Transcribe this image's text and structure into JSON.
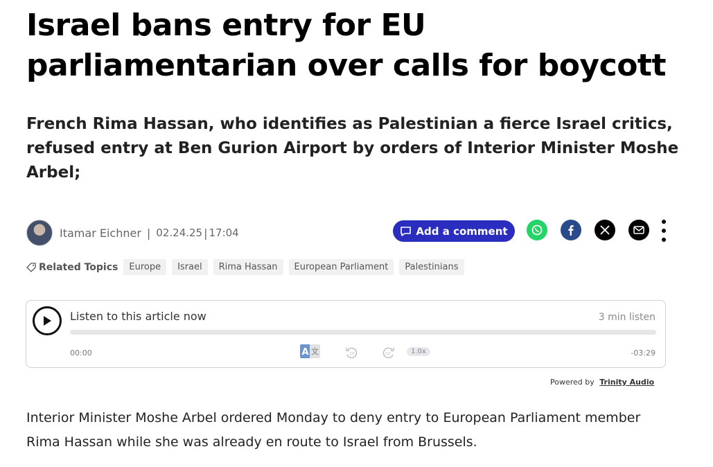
{
  "article": {
    "headline": "Israel bans entry for EU parliamentarian over calls for boycott",
    "subheadline": "French Rima Hassan, who identifies as Palestinian a fierce Israel critics, refused entry at Ben Gurion Airport  by orders of Interior Minister Moshe Arbel;",
    "author": "Itamar Eichner",
    "separator": "|",
    "date": "02.24.25",
    "time": "17:04",
    "body": "Interior Minister Moshe Arbel ordered Monday to deny entry to European Parliament member Rima Hassan while she was already en route to Israel from Brussels."
  },
  "actions": {
    "comment_label": "Add a comment",
    "share_icons": [
      "whatsapp-icon",
      "facebook-icon",
      "x-icon",
      "mail-icon"
    ],
    "colors": {
      "comment": "#2a2dbd",
      "whatsapp": "#25d366",
      "facebook": "#2b4a8b"
    }
  },
  "topics": {
    "label": "Related Topics",
    "tags": [
      "Europe",
      "Israel",
      "Rima Hassan",
      "European Parliament",
      "Palestinians"
    ]
  },
  "player": {
    "title": "Listen to this article now",
    "duration_label": "3 min listen",
    "current_time": "00:00",
    "remaining_time": "-03:29",
    "speed": "1.0x",
    "progress": 0,
    "powered_by": "Powered by",
    "provider": "Trinity Audio"
  }
}
